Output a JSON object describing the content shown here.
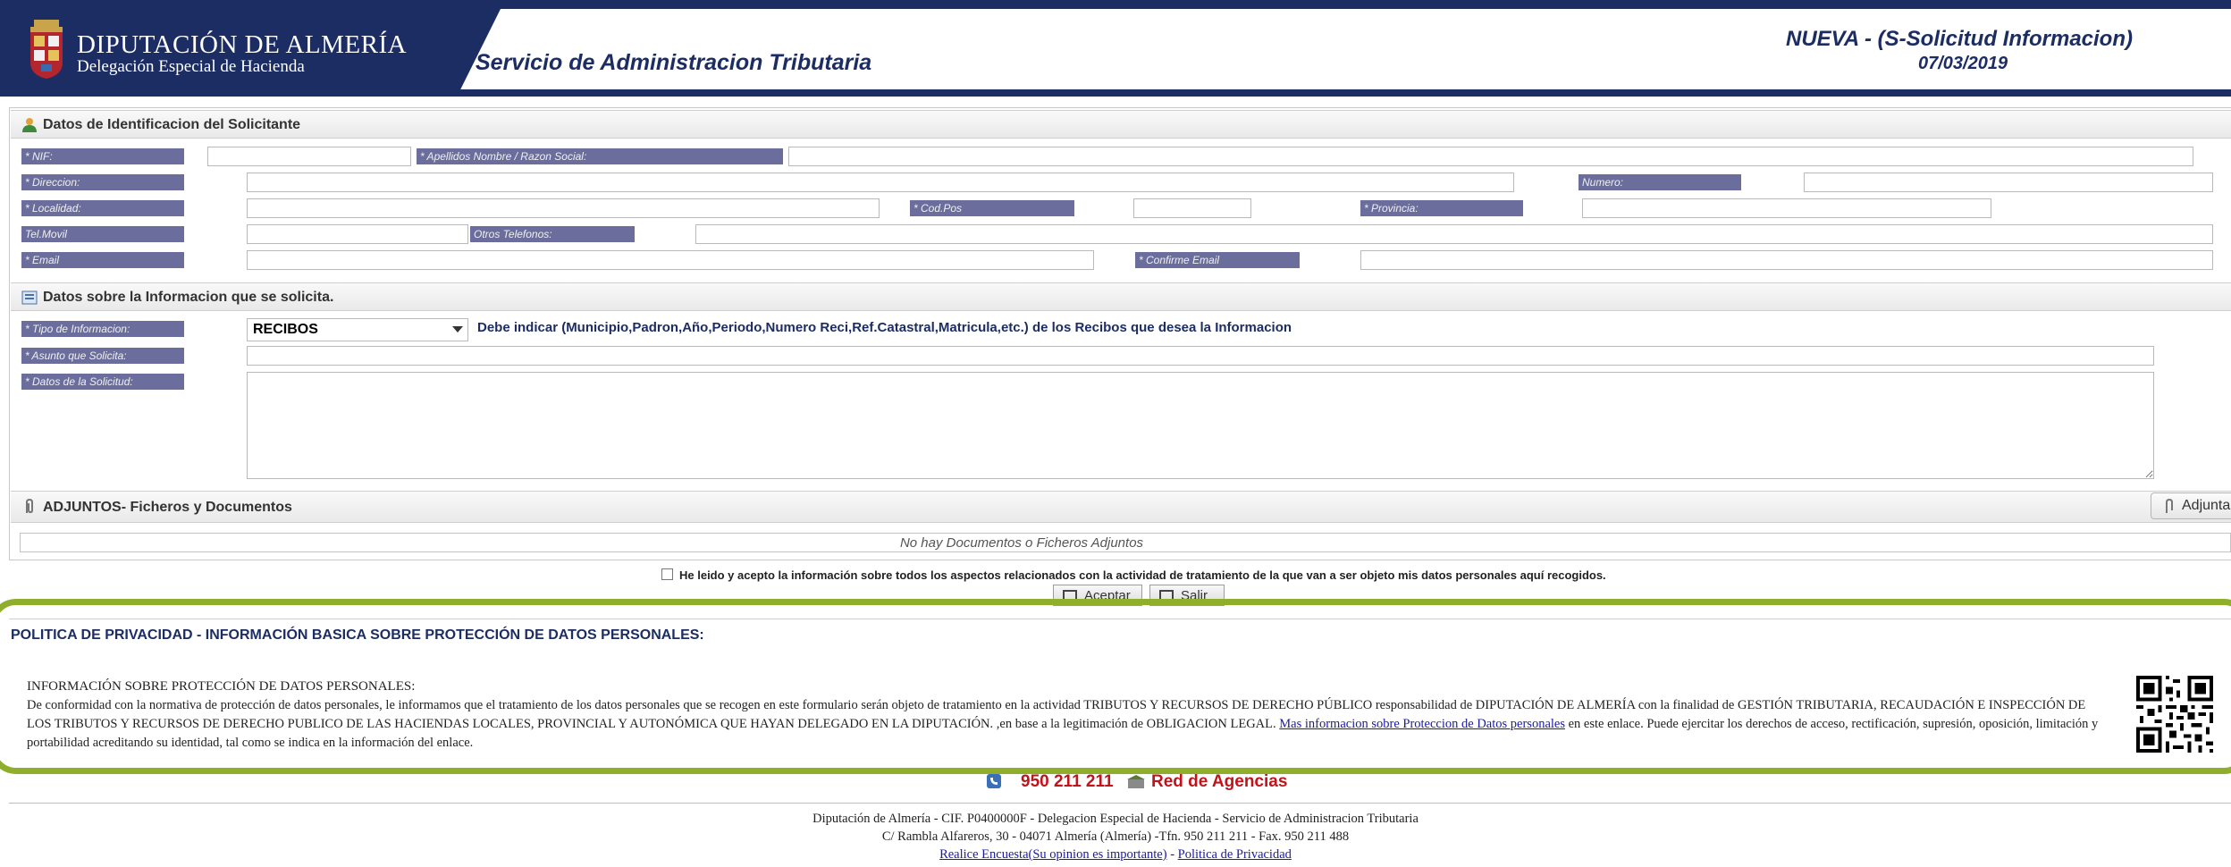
{
  "header": {
    "org_name": "DIPUTACIÓN DE ALMERÍA",
    "org_sub": "Delegación Especial de Hacienda",
    "service_title": "Servicio de Administracion Tributaria",
    "status": "NUEVA - (S-Solicitud Informacion)",
    "date": "07/03/2019"
  },
  "identification": {
    "section_title": "Datos de Identificacion del Solicitante",
    "labels": {
      "nif": "* NIF:",
      "nombre": "* Apellidos Nombre / Razon Social:",
      "direccion": "* Direccion:",
      "numero": "Numero:",
      "localidad": "* Localidad:",
      "codpos": "* Cod.Pos",
      "provincia": "* Provincia:",
      "movil": "Tel.Movil",
      "otros": "Otros Telefonos:",
      "email": "* Email",
      "confirm_email": "* Confirme Email"
    }
  },
  "request": {
    "section_title": "Datos sobre la Informacion que se solicita.",
    "labels": {
      "tipo": "* Tipo de Informacion:",
      "asunto": "* Asunto que Solicita:",
      "datos": "* Datos de la Solicitud:"
    },
    "tipo_value": "RECIBOS",
    "tipo_hint": "Debe indicar (Municipio,Padron,Año,Periodo,Numero Reci,Ref.Catastral,Matricula,etc.) de los Recibos que desea la Informacion"
  },
  "attachments": {
    "section_title": "ADJUNTOS- Ficheros y Documentos",
    "button_label": "Adjunta",
    "empty_text": "No hay Documentos o Ficheros Adjuntos"
  },
  "consent": {
    "text": "He leido y acepto la información sobre todos los aspectos relacionados con la actividad de tratamiento de la que van a ser objeto mis datos personales aquí recogidos.",
    "accept_label": "Aceptar",
    "exit_label": "Salir"
  },
  "privacy": {
    "title": "POLITICA DE PRIVACIDAD - INFORMACIÓN BASICA SOBRE PROTECCIÓN DE DATOS PERSONALES:",
    "heading": "INFORMACIÓN SOBRE PROTECCIÓN DE DATOS PERSONALES:",
    "body": "De conformidad con la normativa de protección de datos personales, le informamos que el tratamiento de los datos personales que se recogen en este formulario serán objeto de tratamiento en la actividad TRIBUTOS Y RECURSOS DE DERECHO PÚBLICO responsabilidad de DIPUTACIÓN DE ALMERÍA con la finalidad de GESTIÓN TRIBUTARIA, RECAUDACIÓN E INSPECCIÓN DE LOS TRIBUTOS Y RECURSOS DE DERECHO PUBLICO DE LAS HACIENDAS LOCALES, PROVINCIAL Y AUTONÓMICA QUE HAYAN DELEGADO EN LA DIPUTACIÓN. ,en base a la legitimación de OBLIGACION LEGAL.",
    "link": "Mas informacion sobre Proteccion de Datos personales",
    "tail": "en este enlace. Puede ejercitar los derechos de acceso, rectificación, supresión, oposición, limitación y portabilidad acreditando su identidad, tal como se indica en la información del enlace."
  },
  "contact": {
    "phone": "950 211 211",
    "agencies": "Red de Agencias"
  },
  "footer": {
    "line1": "Diputación de Almería - CIF. P0400000F - Delegacion Especial de Hacienda - Servicio de Administracion Tributaria",
    "line2": "C/ Rambla Alfareros, 30 - 04071 Almería (Almería) -Tfn. 950 211 211 - Fax. 950 211 488",
    "survey_link": "Realice Encuesta(Su opinion es importante)",
    "separator": "-",
    "privacy_link": "Politica de Privacidad"
  },
  "colors": {
    "navy": "#1c2d63",
    "label_bg": "#6b6e9c",
    "highlight": "#8fae2b",
    "red": "#c0141a"
  }
}
